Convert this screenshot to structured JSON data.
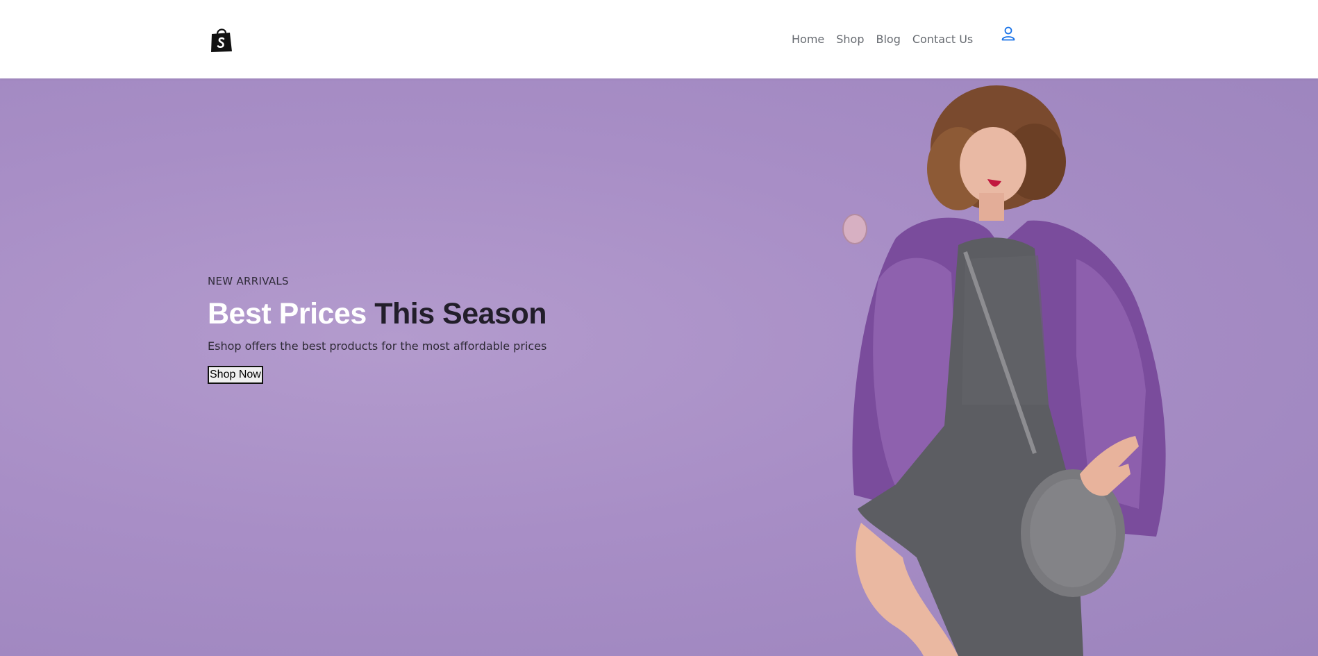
{
  "header": {
    "logo_icon": "shopify-bag-icon",
    "nav": [
      {
        "label": "Home"
      },
      {
        "label": "Shop"
      },
      {
        "label": "Blog"
      },
      {
        "label": "Contact Us"
      }
    ],
    "account_icon": "user-icon",
    "accent_color": "#1a73e8"
  },
  "hero": {
    "eyebrow": "NEW ARRIVALS",
    "headline_light": "Best Prices",
    "headline_dark": "This Season",
    "subtitle": "Eshop offers the best products for the most affordable prices",
    "cta_label": "Shop Now",
    "background_color": "#aa93c8"
  }
}
